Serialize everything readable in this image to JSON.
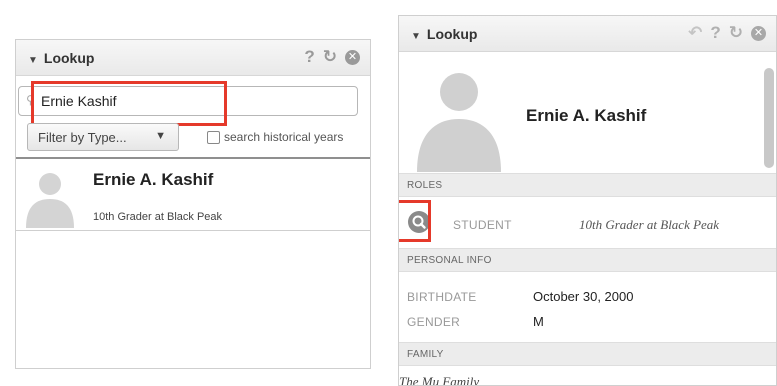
{
  "left_panel": {
    "title": "Lookup",
    "search": {
      "value": "Ernie Kashif",
      "placeholder": ""
    },
    "filter_label": "Filter by Type...",
    "historical_label": "search historical years",
    "result": {
      "name": "Ernie A. Kashif",
      "subtitle": "10th Grader at Black Peak"
    }
  },
  "right_panel": {
    "title": "Lookup",
    "name": "Ernie A. Kashif",
    "roles_header": "ROLES",
    "role_type": "STUDENT",
    "role_desc": "10th Grader at Black Peak",
    "personal_header": "PERSONAL INFO",
    "birthdate_label": "BIRTHDATE",
    "birthdate_value": "October 30, 2000",
    "gender_label": "GENDER",
    "gender_value": "M",
    "family_header": "FAMILY",
    "family_name": "The Mu Family"
  },
  "icons": [
    "collapse-triangle-icon",
    "help-icon",
    "refresh-icon",
    "close-icon",
    "back-arrow-icon",
    "search-icon",
    "person-silhouette-icon"
  ],
  "colors": {
    "highlight": "#e5392a",
    "header_bg": "#ececec",
    "icon_gray": "#9a9a9a"
  }
}
